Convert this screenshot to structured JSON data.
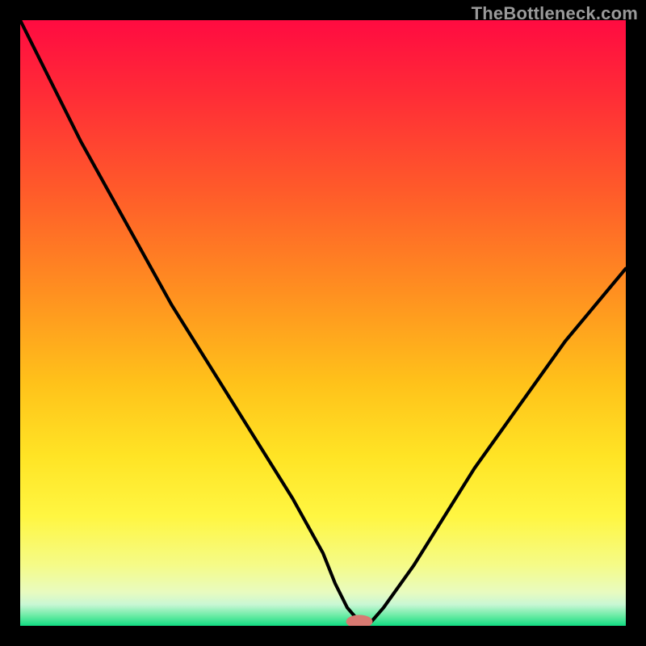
{
  "watermark": "TheBottleneck.com",
  "colors": {
    "bg": "#000000",
    "curve": "#000000",
    "marker_fill": "#d87a72",
    "gradient_stops": [
      {
        "offset": 0.0,
        "color": "#ff0b41"
      },
      {
        "offset": 0.12,
        "color": "#ff2b37"
      },
      {
        "offset": 0.28,
        "color": "#ff5a2a"
      },
      {
        "offset": 0.45,
        "color": "#ff9020"
      },
      {
        "offset": 0.6,
        "color": "#ffc21a"
      },
      {
        "offset": 0.72,
        "color": "#ffe425"
      },
      {
        "offset": 0.82,
        "color": "#fff642"
      },
      {
        "offset": 0.9,
        "color": "#f5fb88"
      },
      {
        "offset": 0.945,
        "color": "#e8fbc0"
      },
      {
        "offset": 0.965,
        "color": "#c8f7d4"
      },
      {
        "offset": 0.985,
        "color": "#62eaa1"
      },
      {
        "offset": 1.0,
        "color": "#11db82"
      }
    ]
  },
  "chart_data": {
    "type": "line",
    "title": "",
    "xlabel": "",
    "ylabel": "",
    "xlim": [
      0,
      100
    ],
    "ylim": [
      0,
      100
    ],
    "x": [
      0,
      5,
      10,
      15,
      20,
      25,
      30,
      35,
      40,
      45,
      50,
      52,
      54,
      56,
      58,
      60,
      65,
      70,
      75,
      80,
      85,
      90,
      95,
      100
    ],
    "series": [
      {
        "name": "bottleneck-curve",
        "values": [
          100,
          90,
          80,
          71,
          62,
          53,
          45,
          37,
          29,
          21,
          12,
          7,
          3,
          0.7,
          0.7,
          3,
          10,
          18,
          26,
          33,
          40,
          47,
          53,
          59
        ]
      }
    ],
    "marker": {
      "x": 56,
      "y": 0.7,
      "rx": 2.2,
      "ry": 1.1
    },
    "grid": false,
    "legend": false
  }
}
